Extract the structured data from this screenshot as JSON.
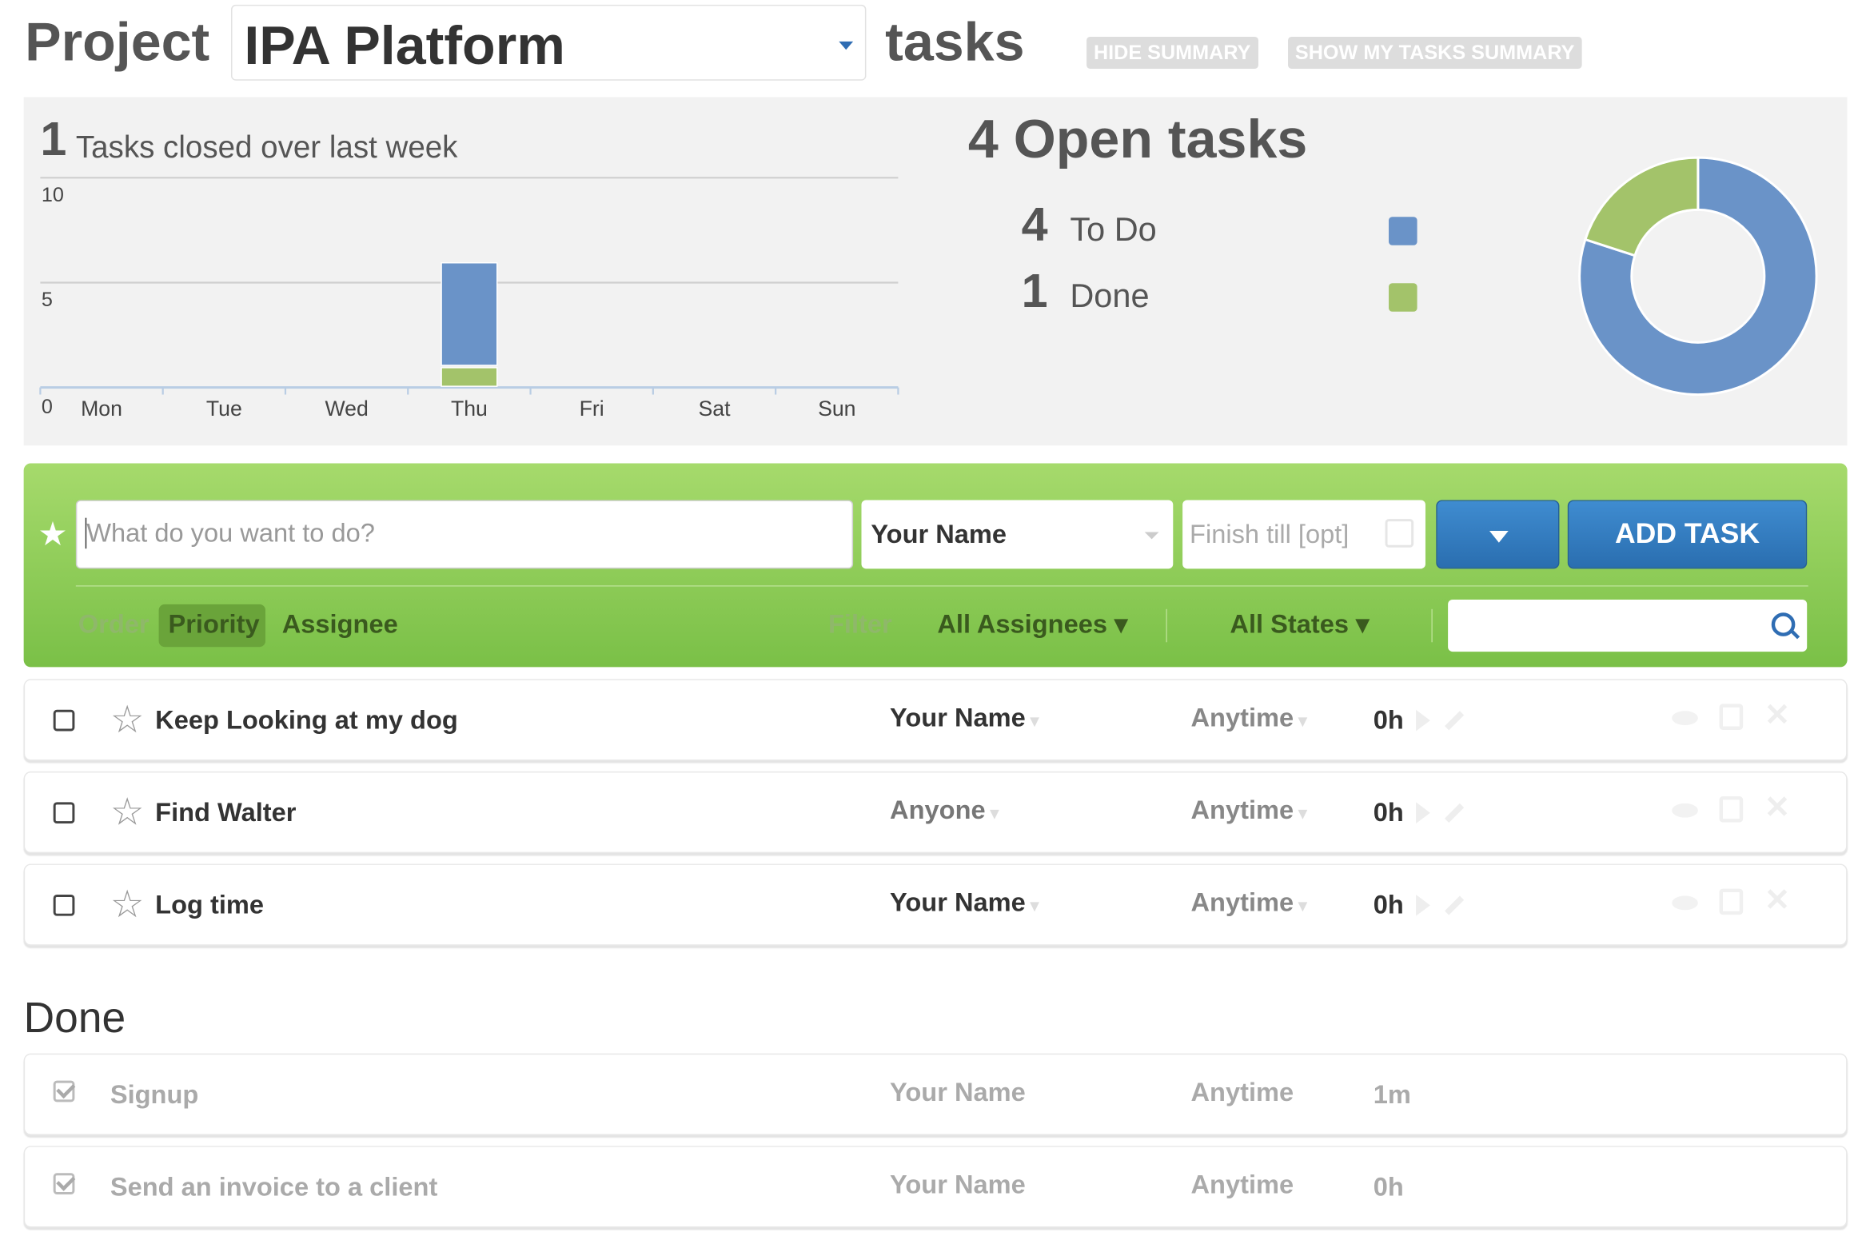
{
  "header": {
    "project_word": "Project",
    "project_name": "IPA Platform",
    "tasks_word": "tasks",
    "hide_summary": "HIDE SUMMARY",
    "show_my_tasks_summary": "SHOW MY TASKS SUMMARY"
  },
  "summary": {
    "closed_count": "1",
    "closed_label": "Tasks closed over last week",
    "open_title": "4 Open tasks",
    "legend": [
      {
        "count": "4",
        "label": "To Do",
        "color": "#6a93c8"
      },
      {
        "count": "1",
        "label": "Done",
        "color": "#a3c36a"
      }
    ]
  },
  "chart_data": [
    {
      "type": "bar",
      "categories": [
        "Mon",
        "Tue",
        "Wed",
        "Thu",
        "Fri",
        "Sat",
        "Sun"
      ],
      "series": [
        {
          "values": [
            0,
            0,
            0,
            1,
            0,
            0,
            0
          ],
          "color": "#a3c36a"
        },
        {
          "values": [
            0,
            0,
            0,
            5,
            0,
            0,
            0
          ],
          "color": "#6a93c8"
        }
      ],
      "stacked": true,
      "ylim": [
        0,
        10
      ],
      "yticks": [
        "0",
        "5",
        "10"
      ],
      "grid": true
    },
    {
      "type": "pie",
      "donut": true,
      "labels": [
        "To Do",
        "Done"
      ],
      "values": [
        4,
        1
      ],
      "colors": [
        "#6a93c8",
        "#a3c36a"
      ]
    }
  ],
  "new_task": {
    "placeholder": "What do you want to do?",
    "assignee": "Your Name",
    "finish_placeholder": "Finish till [opt]",
    "add_label": "ADD TASK"
  },
  "filters": {
    "order_label": "Order",
    "priority": "Priority",
    "assignee": "Assignee",
    "filter_label": "Filter",
    "all_assignees": "All Assignees ▾",
    "all_states": "All States ▾"
  },
  "tasks": [
    {
      "title": "Keep Looking at my dog",
      "assignee": "Your Name",
      "due": "Anytime",
      "hours": "0h"
    },
    {
      "title": "Find Walter",
      "assignee": "Anyone",
      "due": "Anytime",
      "hours": "0h"
    },
    {
      "title": "Log time",
      "assignee": "Your Name",
      "due": "Anytime",
      "hours": "0h"
    }
  ],
  "done": {
    "heading": "Done",
    "items": [
      {
        "title": "Signup",
        "assignee": "Your Name",
        "due": "Anytime",
        "hours": "1m"
      },
      {
        "title": "Send an invoice to a client",
        "assignee": "Your Name",
        "due": "Anytime",
        "hours": "0h"
      }
    ]
  }
}
